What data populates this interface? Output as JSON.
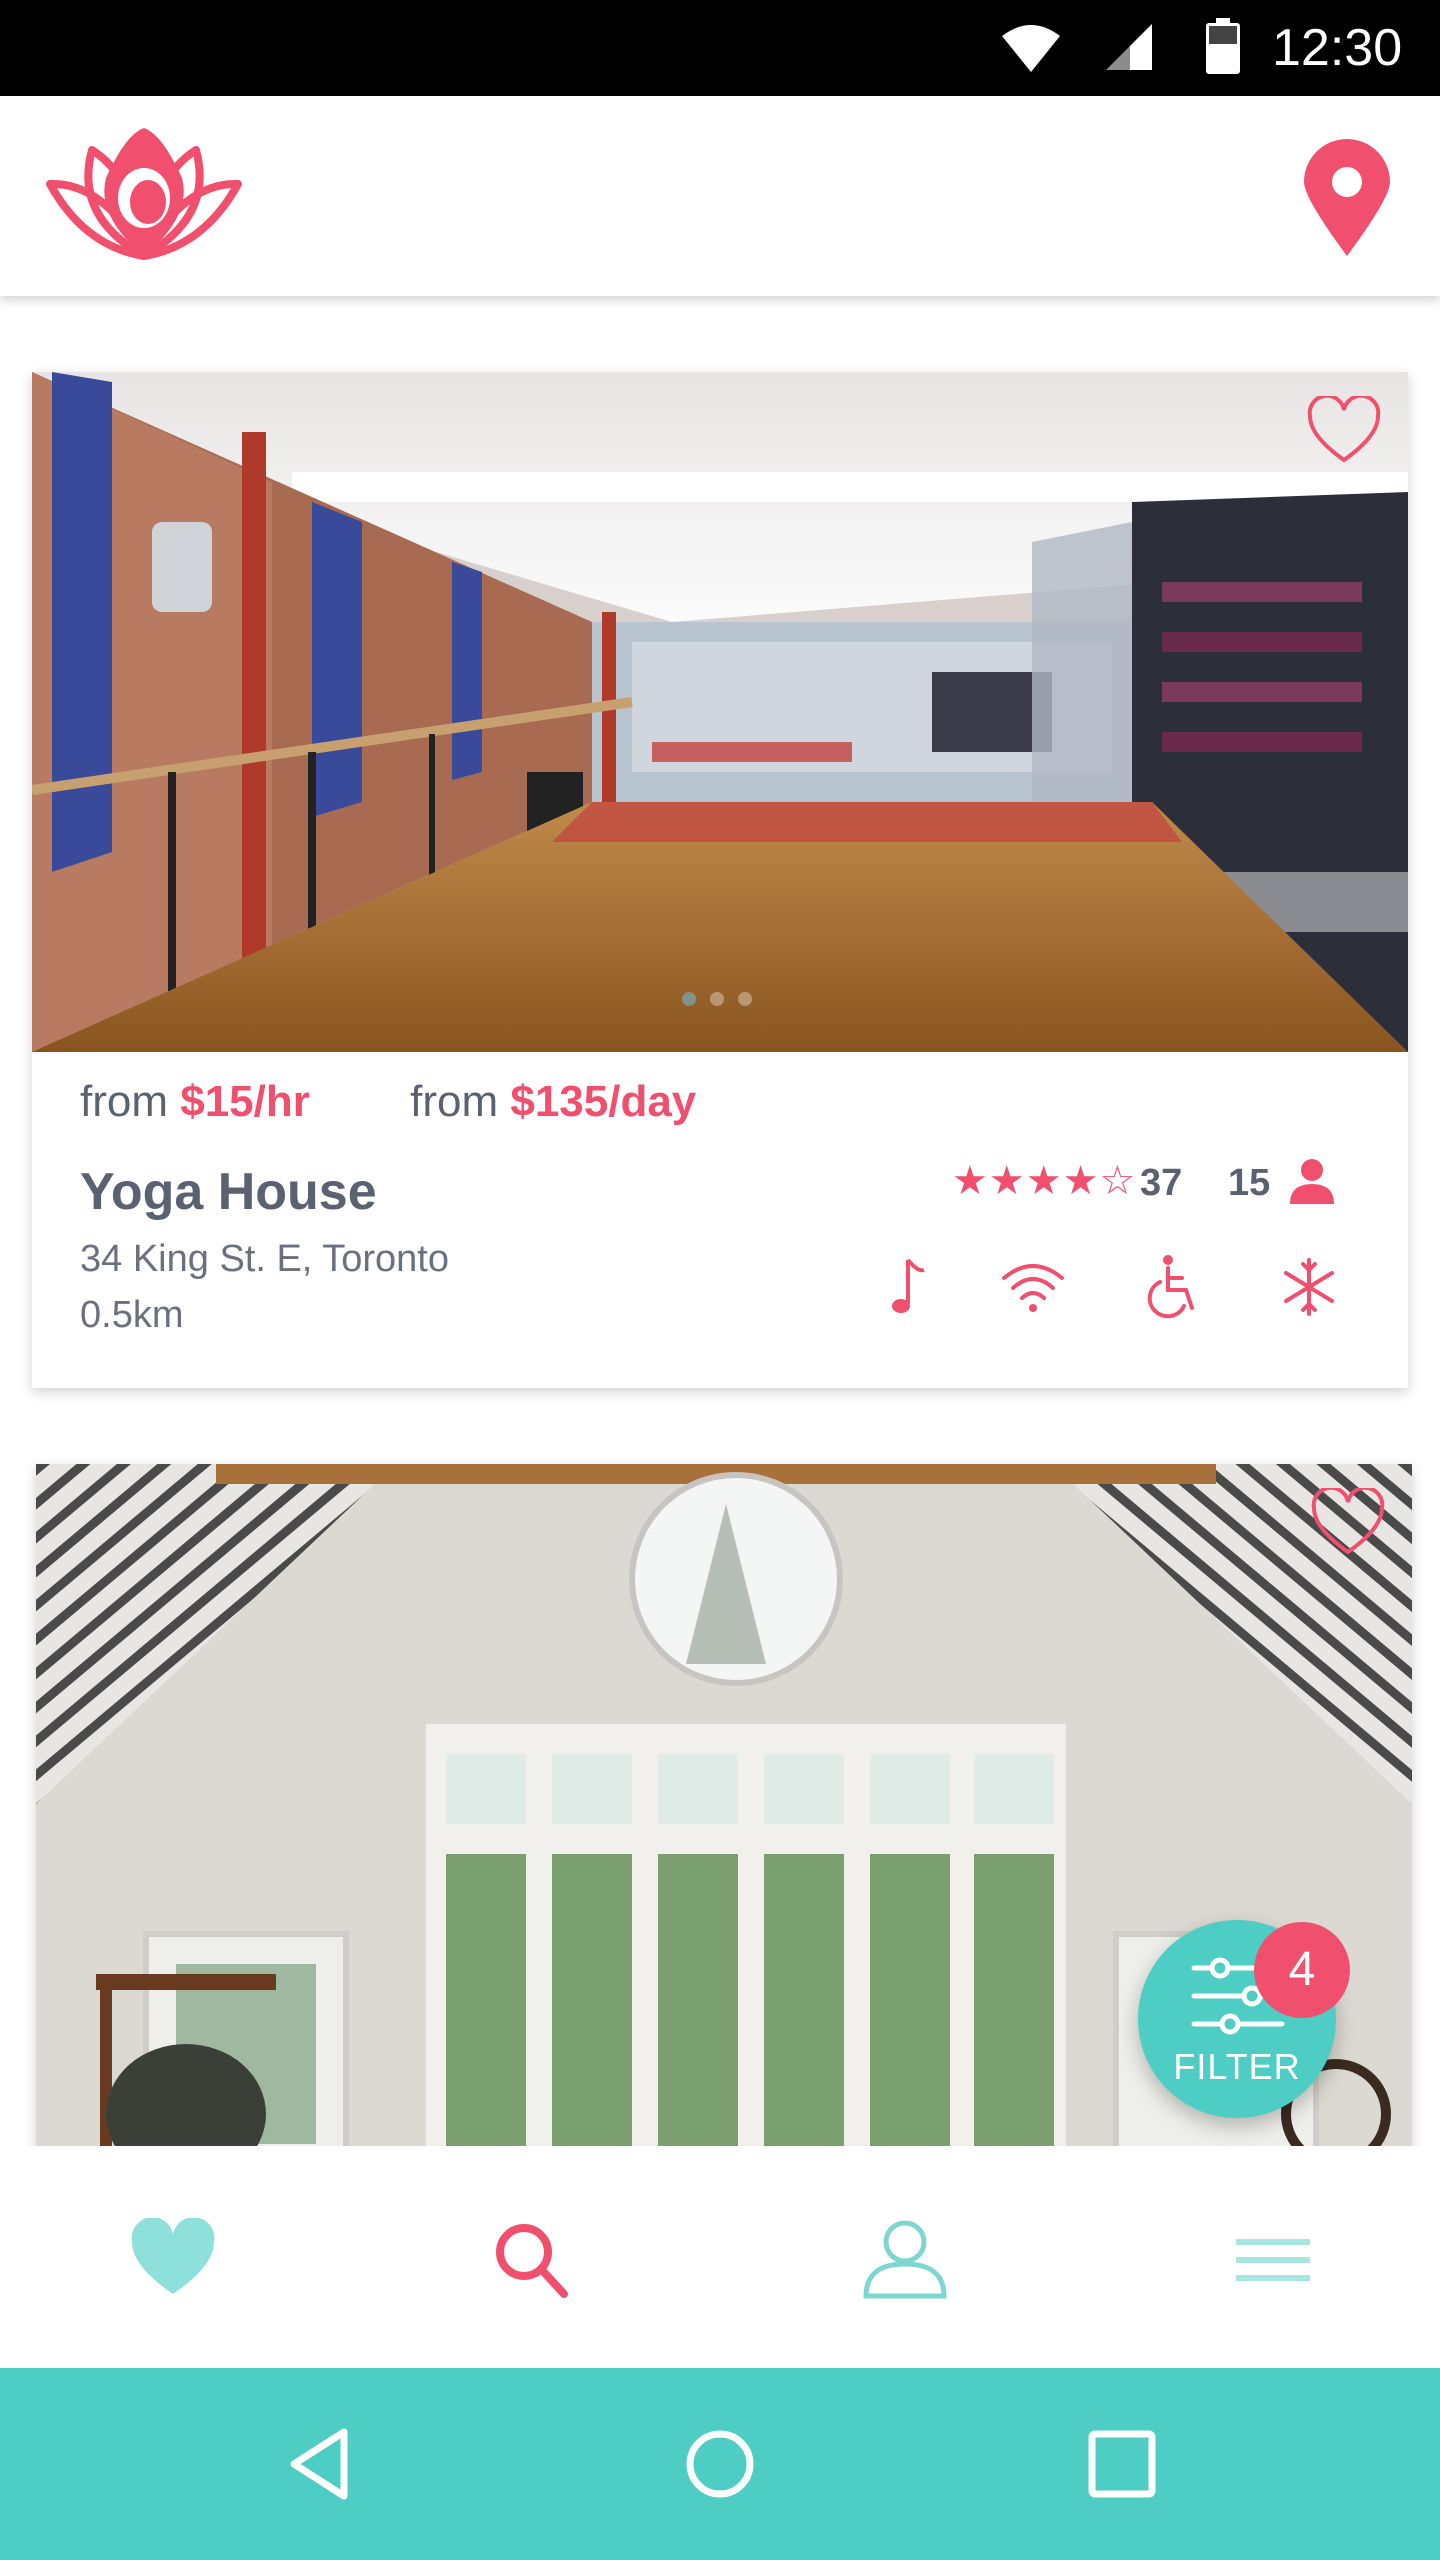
{
  "status_bar": {
    "time": "12:30",
    "icons": [
      "wifi-icon",
      "signal-icon",
      "battery-icon"
    ]
  },
  "header": {
    "logo": "lotus-logo",
    "location_icon": "location-pin-icon"
  },
  "colors": {
    "accent": "#f0506e",
    "teal": "#4ecdc4",
    "text": "#5a6170"
  },
  "listings": [
    {
      "price_hourly_prefix": "from",
      "price_hourly": "$15/hr",
      "price_daily_prefix": "from",
      "price_daily": "$135/day",
      "name": "Yoga House",
      "address": "34 King St. E, Toronto",
      "distance": "0.5km",
      "stars": "★★★★☆",
      "rating_count": "37",
      "capacity": "15",
      "amenities": [
        "music-icon",
        "wifi-icon",
        "accessible-icon",
        "air-conditioning-icon"
      ],
      "carousel_pages": 3,
      "carousel_active": 1
    },
    {
      "photo": "bright studio with round window"
    }
  ],
  "filter": {
    "label": "FILTER",
    "badge": "4"
  },
  "bottom_nav": [
    "favorites-icon",
    "search-icon",
    "profile-icon",
    "menu-icon"
  ],
  "system_nav": [
    "back-icon",
    "home-icon",
    "recents-icon"
  ]
}
